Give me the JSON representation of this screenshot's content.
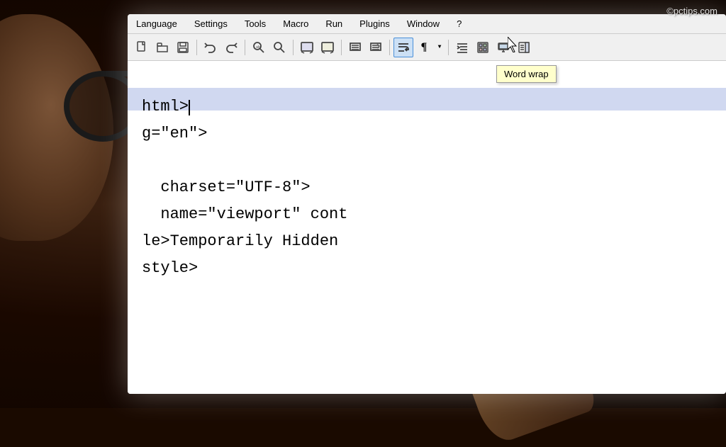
{
  "watermark": {
    "text": "©pctips.com"
  },
  "menu": {
    "items": [
      {
        "label": "Language",
        "id": "language"
      },
      {
        "label": "Settings",
        "id": "settings"
      },
      {
        "label": "Tools",
        "id": "tools"
      },
      {
        "label": "Macro",
        "id": "macro"
      },
      {
        "label": "Run",
        "id": "run"
      },
      {
        "label": "Plugins",
        "id": "plugins"
      },
      {
        "label": "Window",
        "id": "window"
      },
      {
        "label": "?",
        "id": "help"
      }
    ]
  },
  "toolbar": {
    "buttons": [
      {
        "id": "new",
        "icon": "📄",
        "label": "New"
      },
      {
        "id": "open",
        "icon": "📂",
        "label": "Open"
      },
      {
        "id": "save",
        "icon": "💾",
        "label": "Save"
      },
      {
        "id": "separator1",
        "type": "separator"
      },
      {
        "id": "undo",
        "icon": "↩",
        "label": "Undo"
      },
      {
        "id": "redo",
        "icon": "↪",
        "label": "Redo"
      },
      {
        "id": "separator2",
        "type": "separator"
      },
      {
        "id": "find",
        "icon": "🔍",
        "label": "Find"
      },
      {
        "id": "findreplace",
        "icon": "🔎",
        "label": "Find Replace"
      },
      {
        "id": "separator3",
        "type": "separator"
      },
      {
        "id": "zoomin",
        "icon": "🔬",
        "label": "Zoom In"
      },
      {
        "id": "zoomout",
        "icon": "🔭",
        "label": "Zoom Out"
      },
      {
        "id": "separator4",
        "type": "separator"
      },
      {
        "id": "syncscroll1",
        "icon": "🖼",
        "label": "Sync Scroll"
      },
      {
        "id": "syncscroll2",
        "icon": "🗃",
        "label": "Sync Scroll 2"
      },
      {
        "id": "separator5",
        "type": "separator"
      },
      {
        "id": "wordwrap",
        "icon": "⇌",
        "label": "Word wrap",
        "active": true
      },
      {
        "id": "pilcrow",
        "icon": "¶",
        "label": "Show all characters"
      },
      {
        "id": "dropdownarrow",
        "icon": "▼",
        "label": "Dropdown"
      },
      {
        "id": "separator6",
        "type": "separator"
      },
      {
        "id": "indent",
        "icon": "≡",
        "label": "Indent"
      },
      {
        "id": "thumbnail",
        "icon": "🖼",
        "label": "Thumbnail"
      },
      {
        "id": "monitor",
        "icon": "🗺",
        "label": "Monitor"
      },
      {
        "id": "docmap",
        "icon": "📋",
        "label": "Document Map"
      }
    ]
  },
  "tooltip": {
    "text": "Word wrap"
  },
  "editor": {
    "lines": [
      "",
      "ht ml>",
      "g=\"en\">",
      "",
      "charset=\"UTF-8\">",
      "name=\"viewport\" cont",
      "le>Temporarily Hidden",
      "style>"
    ]
  }
}
